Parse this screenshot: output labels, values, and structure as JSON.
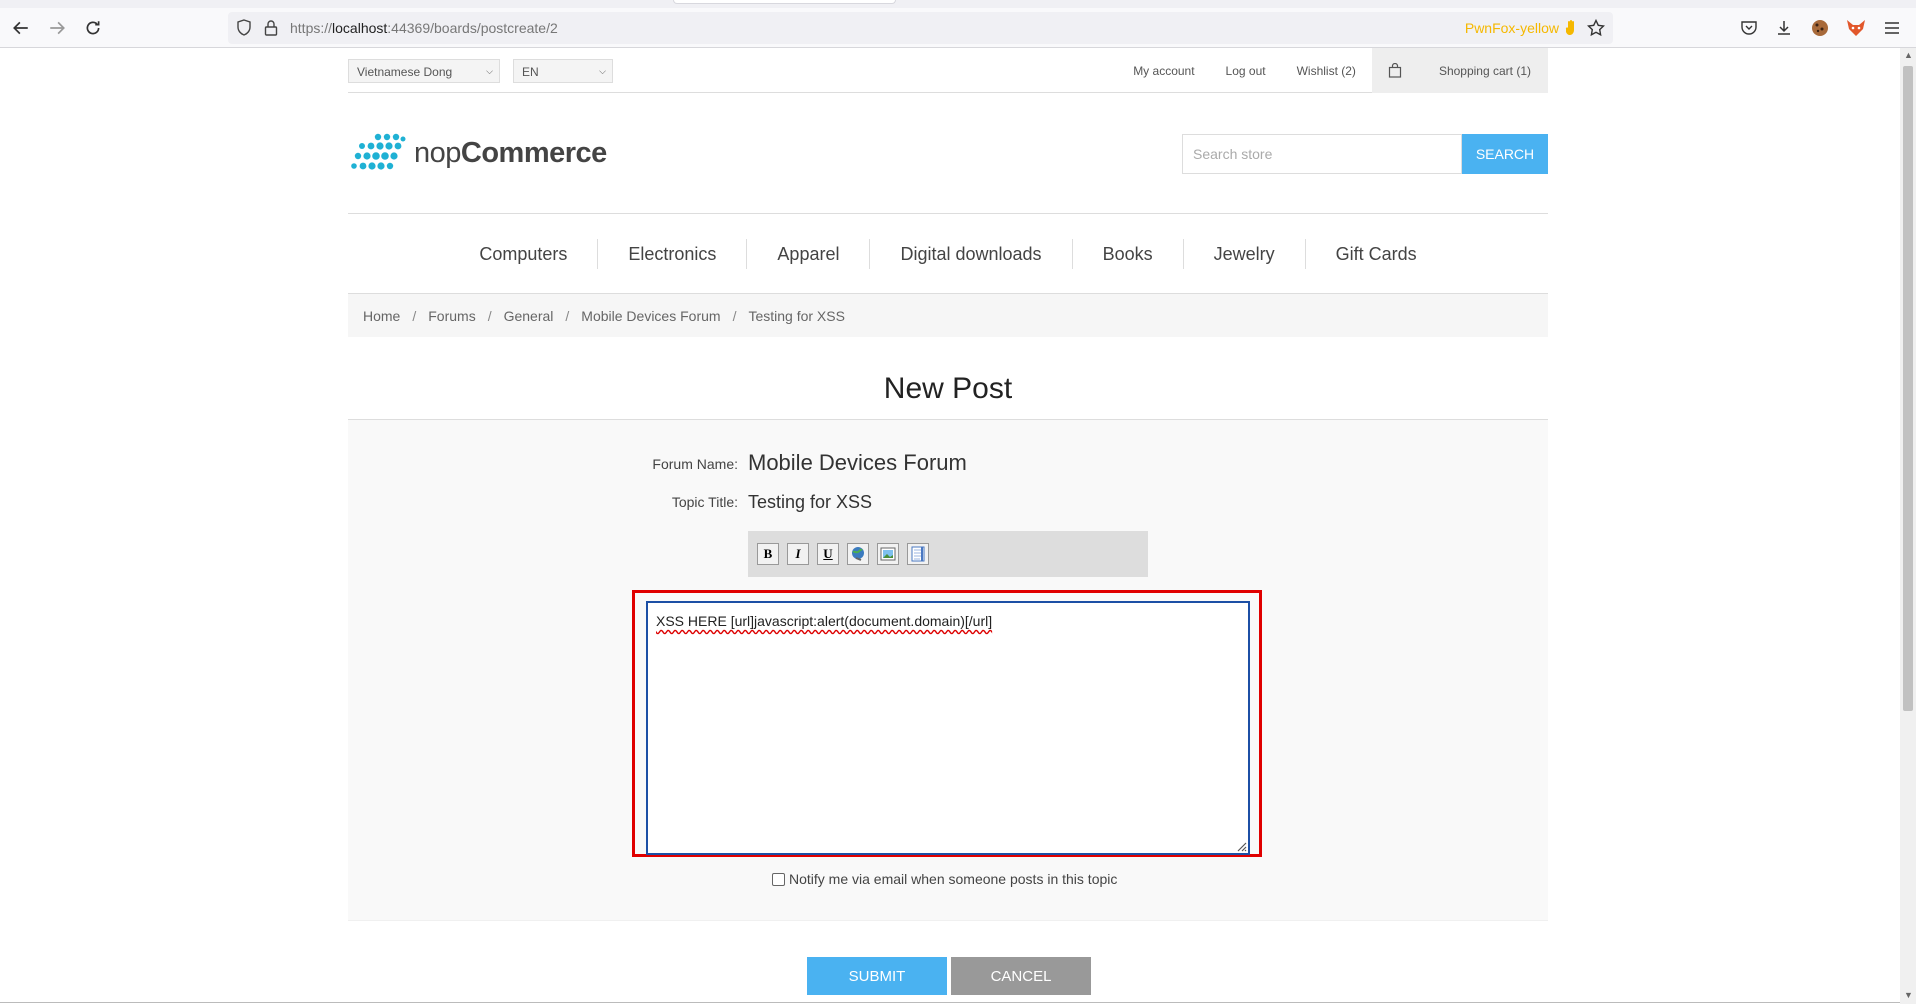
{
  "browser": {
    "url_prefix": "https://",
    "url_host": "localhost",
    "url_rest": ":44369/boards/postcreate/2",
    "container_label": "PwnFox-yellow"
  },
  "header": {
    "currency": "Vietnamese Dong",
    "language": "EN",
    "links": {
      "my_account": "My account",
      "log_out": "Log out",
      "wishlist": "Wishlist (2)",
      "cart": "Shopping cart (1)"
    },
    "logo_text_light": "nop",
    "logo_text_bold": "Commerce",
    "search_placeholder": "Search store",
    "search_button": "SEARCH"
  },
  "menu": [
    "Computers",
    "Electronics",
    "Apparel",
    "Digital downloads",
    "Books",
    "Jewelry",
    "Gift Cards"
  ],
  "breadcrumb": [
    "Home",
    "Forums",
    "General",
    "Mobile Devices Forum",
    "Testing for XSS"
  ],
  "page_title": "New Post",
  "form": {
    "forum_name_label": "Forum Name:",
    "forum_name": "Mobile Devices Forum",
    "topic_title_label": "Topic Title:",
    "topic_title": "Testing for XSS",
    "toolbar": [
      "B",
      "I",
      "U"
    ],
    "toolbar_icons": [
      "bold-icon",
      "italic-icon",
      "underline-icon",
      "link-icon",
      "image-icon",
      "quote-icon"
    ],
    "post_text": "XSS HERE [url]javascript:alert(document.domain)[/url]",
    "notify_label": "Notify me via email when someone posts in this topic",
    "notify_checked": false,
    "submit": "SUBMIT",
    "cancel": "CANCEL"
  },
  "colors": {
    "accent": "#4ab2f1",
    "highlight_box": "#e00000",
    "logo": "#1fb1d4"
  }
}
